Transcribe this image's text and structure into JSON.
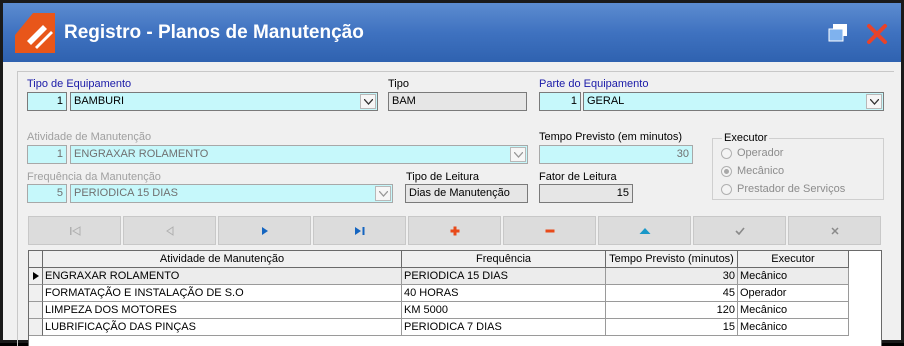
{
  "window": {
    "title": "Registro - Planos de Manutenção"
  },
  "tipo_equipamento": {
    "label": "Tipo de Equipamento",
    "code": "1",
    "name": "BAMBURI"
  },
  "tipo": {
    "label": "Tipo",
    "value": "BAM"
  },
  "parte_equipamento": {
    "label": "Parte do Equipamento",
    "code": "1",
    "name": "GERAL"
  },
  "atividade": {
    "label": "Atividade de Manutenção",
    "code": "1",
    "name": "ENGRAXAR ROLAMENTO"
  },
  "tempo_previsto": {
    "label": "Tempo Previsto (em minutos)",
    "value": "30"
  },
  "executor": {
    "label": "Executor",
    "options": [
      "Operador",
      "Mecânico",
      "Prestador de Serviços"
    ],
    "selected": "Mecânico"
  },
  "frequencia": {
    "label": "Frequência da Manutenção",
    "code": "5",
    "name": "PERIODICA 15 DIAS"
  },
  "tipo_leitura": {
    "label": "Tipo de Leitura",
    "value": "Dias de Manutenção"
  },
  "fator_leitura": {
    "label": "Fator de Leitura",
    "value": "15"
  },
  "navigator": {
    "buttons": [
      {
        "id": "first",
        "icon": "first-record-icon",
        "enabled": false
      },
      {
        "id": "prior",
        "icon": "prior-record-icon",
        "enabled": false
      },
      {
        "id": "next",
        "icon": "next-record-icon",
        "enabled": true
      },
      {
        "id": "last",
        "icon": "last-record-icon",
        "enabled": true
      },
      {
        "id": "insert",
        "icon": "plus-icon",
        "enabled": true
      },
      {
        "id": "delete",
        "icon": "minus-icon",
        "enabled": true
      },
      {
        "id": "edit",
        "icon": "triangle-up-icon",
        "enabled": true
      },
      {
        "id": "post",
        "icon": "check-icon",
        "enabled": false
      },
      {
        "id": "cancel",
        "icon": "x-icon",
        "enabled": false
      }
    ]
  },
  "grid": {
    "columns": [
      "Atividade de Manutenção",
      "Frequência",
      "Tempo Previsto (minutos)",
      "Executor"
    ],
    "rows": [
      [
        "ENGRAXAR ROLAMENTO",
        "PERIODICA 15 DIAS",
        "30",
        "Mecânico"
      ],
      [
        "FORMATAÇÃO E INSTALAÇÃO DE S.O",
        "40 HORAS",
        "45",
        "Operador"
      ],
      [
        "LIMPEZA DOS MOTORES",
        "KM 5000",
        "120",
        "Mecânico"
      ],
      [
        "LUBRIFICAÇÃO DAS PINÇAS",
        "PERIODICA 7 DIAS",
        "15",
        "Mecânico"
      ]
    ],
    "selected_row": 0
  },
  "colors": {
    "titlebar": "#3f72c0",
    "field_cyan": "#c6f8fb",
    "logo_orange": "#e8561a",
    "close_red": "#e8432a",
    "nav_blue": "#1565c0",
    "nav_red": "#e84a1a"
  }
}
